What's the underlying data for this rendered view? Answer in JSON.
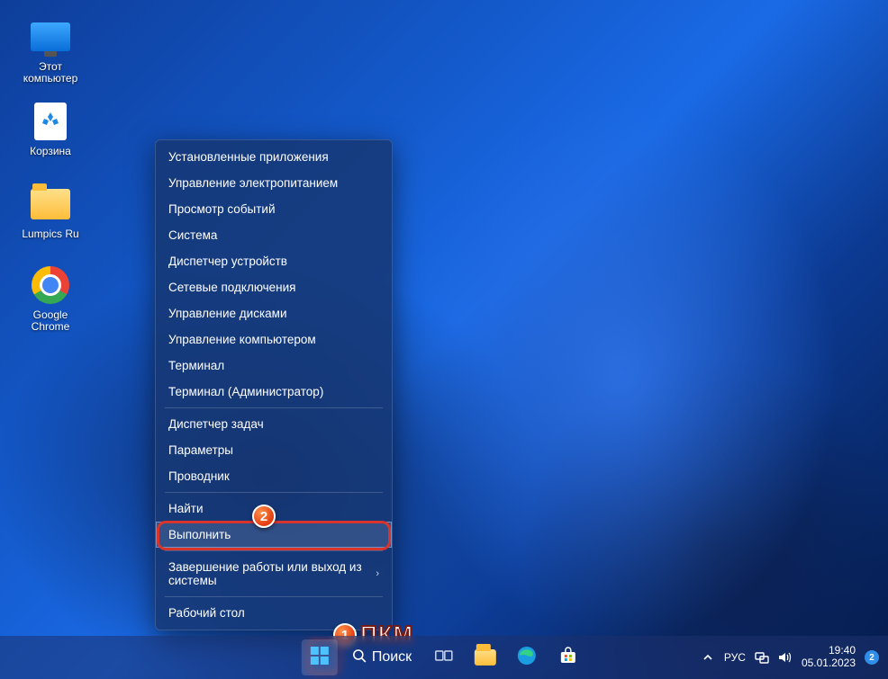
{
  "desktop_icons": [
    {
      "name": "this-pc",
      "label": "Этот\nкомпьютер"
    },
    {
      "name": "recycle-bin",
      "label": "Корзина"
    },
    {
      "name": "lumpics-folder",
      "label": "Lumpics Ru"
    },
    {
      "name": "google-chrome",
      "label": "Google\nChrome"
    }
  ],
  "context_menu": {
    "items": [
      {
        "label": "Установленные приложения"
      },
      {
        "label": "Управление электропитанием"
      },
      {
        "label": "Просмотр событий"
      },
      {
        "label": "Система"
      },
      {
        "label": "Диспетчер устройств"
      },
      {
        "label": "Сетевые подключения"
      },
      {
        "label": "Управление дисками"
      },
      {
        "label": "Управление компьютером"
      },
      {
        "label": "Терминал"
      },
      {
        "label": "Терминал (Администратор)"
      },
      {
        "label": "Диспетчер задач"
      },
      {
        "label": "Параметры"
      },
      {
        "label": "Проводник"
      },
      {
        "label": "Найти"
      },
      {
        "label": "Выполнить"
      },
      {
        "label": "Завершение работы или выход из системы",
        "submenu": true
      },
      {
        "label": "Рабочий стол"
      }
    ],
    "highlighted_index": 14,
    "separators_after": [
      9,
      12,
      14,
      15
    ]
  },
  "annotations": {
    "badge1": "1",
    "badge2": "2",
    "right_click_label": "ПКМ"
  },
  "taskbar": {
    "search_placeholder": "Поиск",
    "language": "РУС",
    "time": "19:40",
    "date": "05.01.2023",
    "notification_count": "2"
  }
}
